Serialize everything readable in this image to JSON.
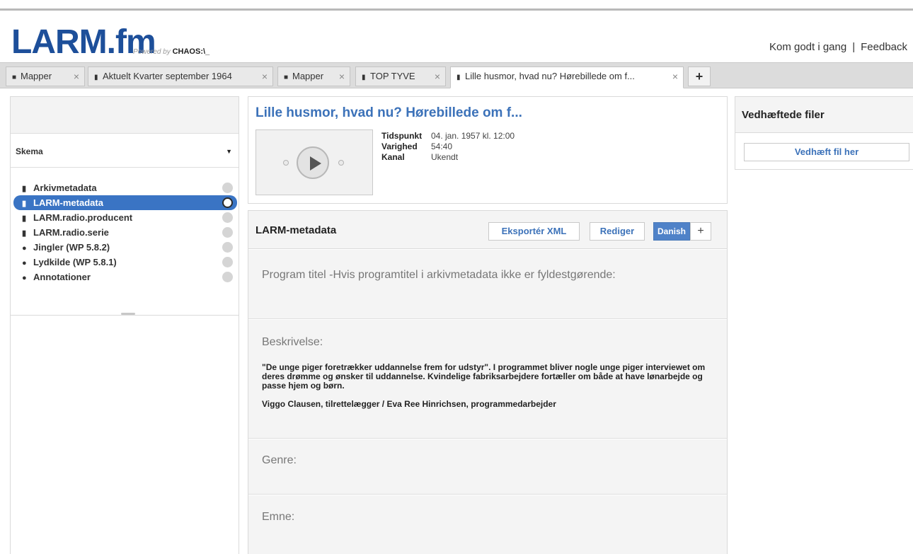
{
  "header": {
    "logo_text": "LARM",
    "logo_suffix": ".fm",
    "powered_by": "Powered by",
    "powered_brand": "CHAOS:\\_",
    "links": [
      "Kom godt i gang",
      "Feedback"
    ],
    "link_separator": "|"
  },
  "tabs": [
    {
      "label": "Mapper",
      "icon": "folder-icon"
    },
    {
      "label": "Aktuelt Kvarter september 1964",
      "icon": "file-icon"
    },
    {
      "label": "Mapper",
      "icon": "folder-icon"
    },
    {
      "label": "TOP TYVE",
      "icon": "file-icon"
    },
    {
      "label": "Lille husmor, hvad nu? Hørebillede om f...",
      "icon": "file-icon",
      "active": true
    }
  ],
  "tab_close": "×",
  "tab_add": "+",
  "sidebar": {
    "schema_label": "Skema",
    "items": [
      {
        "label": "Arkivmetadata",
        "icon": "file-icon"
      },
      {
        "label": "LARM-metadata",
        "icon": "file-icon",
        "selected": true
      },
      {
        "label": "LARM.radio.producent",
        "icon": "file-icon"
      },
      {
        "label": "LARM.radio.serie",
        "icon": "file-icon"
      },
      {
        "label": "Jingler (WP 5.8.2)",
        "icon": "comment-icon"
      },
      {
        "label": "Lydkilde (WP 5.8.1)",
        "icon": "comment-icon"
      },
      {
        "label": "Annotationer",
        "icon": "comment-icon"
      }
    ]
  },
  "media": {
    "title": "Lille husmor, hvad nu? Hørebillede om f...",
    "meta": [
      {
        "key": "Tidspunkt",
        "value": "04. jan. 1957 kl. 12:00"
      },
      {
        "key": "Varighed",
        "value": "54:40"
      },
      {
        "key": "Kanal",
        "value": "Ukendt"
      }
    ]
  },
  "metadata_panel": {
    "title": "LARM-metadata",
    "export_label": "Eksportér XML",
    "edit_label": "Rediger",
    "language": "Danish",
    "add_language": "+",
    "fields": [
      {
        "label": "Program titel -Hvis programtitel i arkivmetadata ikke er fyldestgørende:"
      },
      {
        "label": "Beskrivelse:",
        "paragraphs": [
          "\"De unge piger foretrækker uddannelse frem for udstyr\". I programmet bliver nogle unge piger interviewet om deres drømme og ønsker til uddannelse. Kvindelige fabriksarbejdere fortæller om både at have lønarbejde og passe hjem og børn.",
          "Viggo Clausen, tilrettelægger / Eva Ree Hinrichsen, programmedarbejder"
        ]
      },
      {
        "label": "Genre:"
      },
      {
        "label": "Emne:"
      }
    ]
  },
  "attachments": {
    "title": "Vedhæftede filer",
    "attach_label": "Vedhæft fil her"
  }
}
